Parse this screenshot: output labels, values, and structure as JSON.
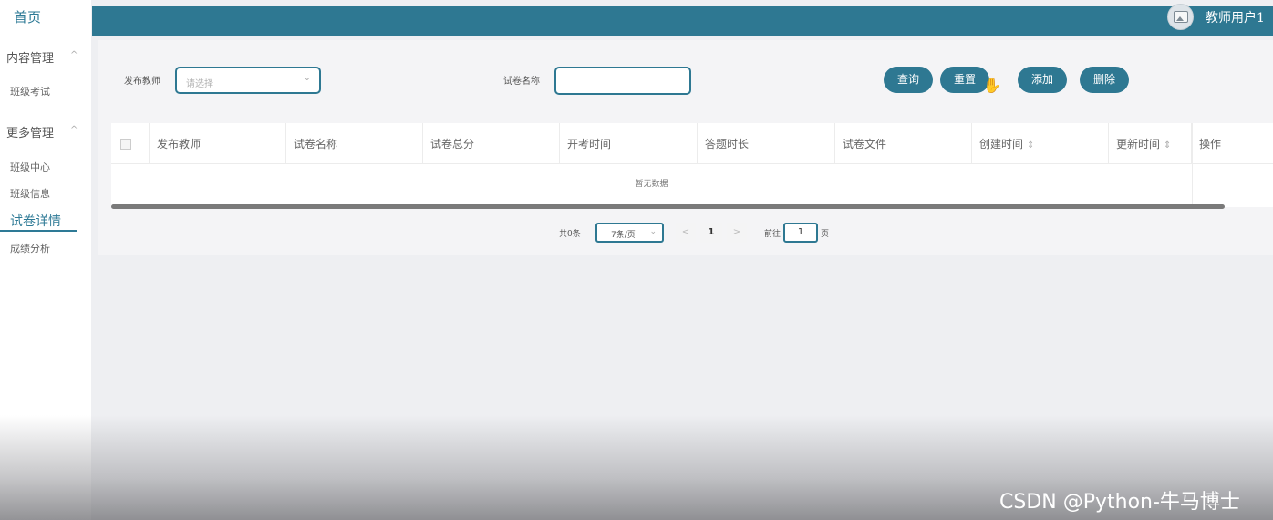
{
  "sidebar": {
    "home": "首页",
    "groups": [
      {
        "label": "内容管理",
        "caret": "^",
        "items": [
          "班级考试"
        ]
      },
      {
        "label": "更多管理",
        "caret": "^",
        "items": [
          "班级中心",
          "班级信息",
          "试卷详情",
          "成绩分析"
        ]
      }
    ],
    "active_item": "试卷详情"
  },
  "header": {
    "username": "教师用户1"
  },
  "search": {
    "teacher_label": "发布教师",
    "teacher_placeholder": "请选择",
    "paper_label": "试卷名称",
    "paper_value": ""
  },
  "actions": {
    "query": "查询",
    "reset": "重置",
    "add": "添加",
    "delete": "删除"
  },
  "table": {
    "columns": [
      "发布教师",
      "试卷名称",
      "试卷总分",
      "开考时间",
      "答题时长",
      "试卷文件",
      "创建时间",
      "更新时间",
      "操作"
    ],
    "sortable_mark": "⇕",
    "empty_text": "暂无数据"
  },
  "pagination": {
    "total": "共0条",
    "page_size": "7条/页",
    "prev": "<",
    "current": "1",
    "next": ">",
    "goto_label": "前往",
    "goto_value": "1",
    "page_suffix": "页"
  },
  "watermark": "CSDN @Python-牛马博士",
  "colors": {
    "primary": "#2e7892",
    "background": "#eeeff2"
  }
}
